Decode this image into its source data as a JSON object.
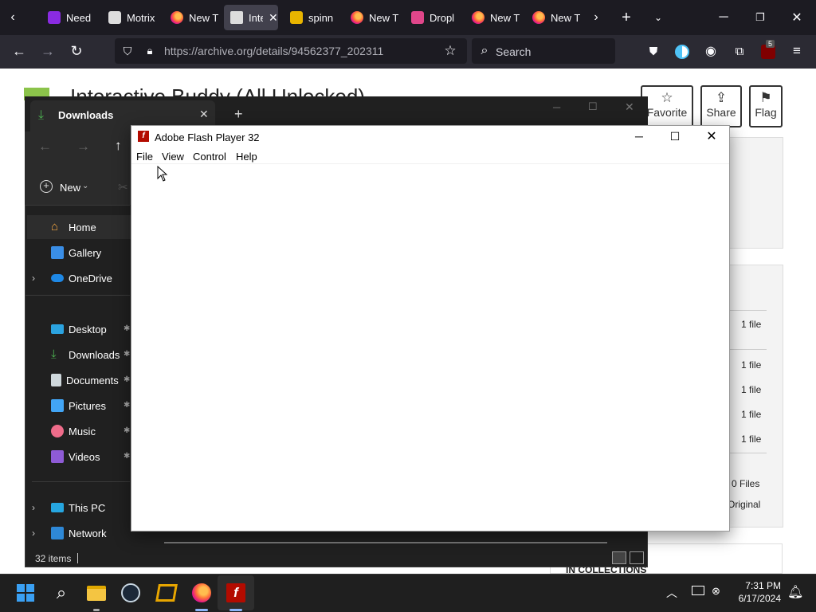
{
  "browser": {
    "tabs": [
      {
        "label": "Need",
        "active": false
      },
      {
        "label": "Motrix",
        "active": false
      },
      {
        "label": "New T",
        "active": false
      },
      {
        "label": "Inte",
        "active": true
      },
      {
        "label": "spinn",
        "active": false
      },
      {
        "label": "New T",
        "active": false
      },
      {
        "label": "Dropl",
        "active": false
      },
      {
        "label": "New T",
        "active": false
      },
      {
        "label": "New T",
        "active": false
      }
    ],
    "url": "https://archive.org/details/94562377_202311",
    "search_placeholder": "Search",
    "extension_badge": "5"
  },
  "archive_page": {
    "title": "Interactive Buddy (All Unlocked)",
    "favorite_label": "Favorite",
    "share_label": "Share",
    "flag_label": "Flag",
    "file_counts": [
      "1 file",
      "1 file",
      "1 file",
      "1 file",
      "1 file"
    ],
    "total_files": "0 Files",
    "original_label": "Original",
    "collections_label": "IN COLLECTIONS"
  },
  "explorer": {
    "tab_title": "Downloads",
    "new_label": "New",
    "sidebar": {
      "home": "Home",
      "gallery": "Gallery",
      "onedrive": "OneDrive",
      "desktop": "Desktop",
      "downloads": "Downloads",
      "documents": "Documents",
      "pictures": "Pictures",
      "music": "Music",
      "videos": "Videos",
      "this_pc": "This PC",
      "network": "Network"
    },
    "status": "32 items"
  },
  "flash": {
    "title": "Adobe Flash Player 32",
    "menu": {
      "file": "File",
      "view": "View",
      "control": "Control",
      "help": "Help"
    }
  },
  "taskbar": {
    "time": "7:31 PM",
    "date": "6/17/2024"
  },
  "colors": {
    "firefox_bg": "#1c1b22",
    "explorer_bg": "#202020",
    "flash_red": "#b30b00",
    "accent_blue": "#0078d4"
  }
}
